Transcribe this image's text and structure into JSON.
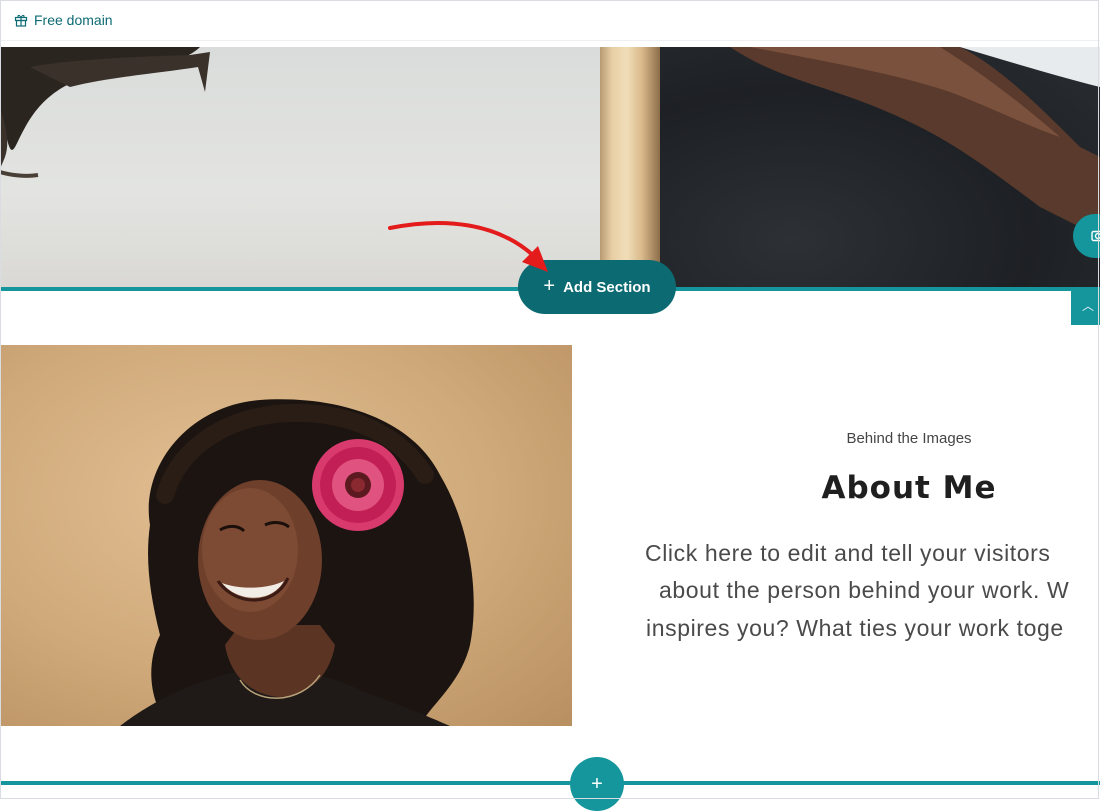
{
  "topbar": {
    "free_domain_label": "Free domain",
    "icon": "gift-icon"
  },
  "toolbar": {
    "add_section_label": "Add Section"
  },
  "about": {
    "eyebrow": "Behind the Images",
    "title": "About Me",
    "body_lines": [
      "Click here to edit and tell your visitors",
      "about the person behind your work. W",
      "inspires you? What ties your work toge"
    ]
  },
  "icons": {
    "camera": "camera-icon",
    "collapse": "chevron-up-icon",
    "add": "plus-icon"
  },
  "colors": {
    "teal": "#14969c",
    "teal_dark": "#0c6a72",
    "annotation": "#e31b1b",
    "link": "#0e6b73"
  }
}
